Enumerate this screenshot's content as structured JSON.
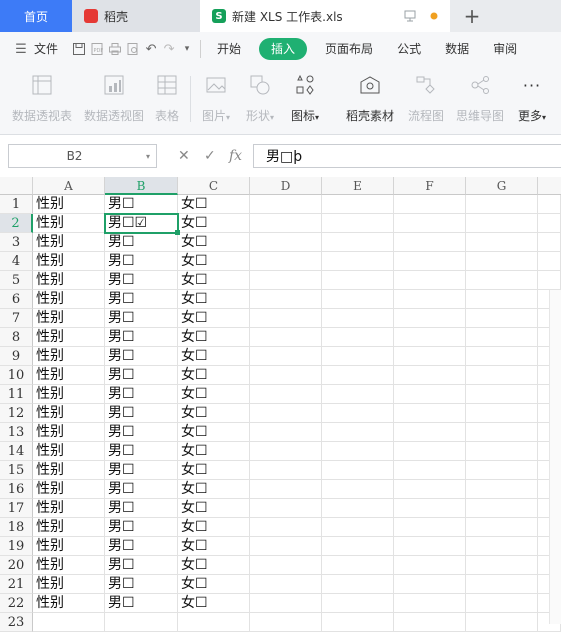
{
  "tabs": {
    "home": "首页",
    "daoke": "稻壳",
    "file": "新建 XLS 工作表.xls"
  },
  "menu": {
    "file": "文件",
    "items": [
      "开始",
      "插入",
      "页面布局",
      "公式",
      "数据",
      "审阅"
    ],
    "active": "插入"
  },
  "ribbon": [
    {
      "label": "数据透视表",
      "icon": "pivot-table-icon",
      "enabled": false
    },
    {
      "label": "数据透视图",
      "icon": "pivot-chart-icon",
      "enabled": false
    },
    {
      "label": "表格",
      "icon": "table-icon",
      "enabled": false
    },
    {
      "label": "图片",
      "icon": "picture-icon",
      "enabled": false,
      "dropdown": true
    },
    {
      "label": "形状",
      "icon": "shape-icon",
      "enabled": false,
      "dropdown": true
    },
    {
      "label": "图标",
      "icon": "icon-library-icon",
      "enabled": true,
      "dropdown": true
    },
    {
      "label": "稻壳素材",
      "icon": "daoke-material-icon",
      "enabled": true
    },
    {
      "label": "流程图",
      "icon": "flowchart-icon",
      "enabled": false
    },
    {
      "label": "思维导图",
      "icon": "mindmap-icon",
      "enabled": false
    },
    {
      "label": "更多",
      "icon": "more-icon",
      "enabled": true,
      "dropdown": true
    }
  ],
  "formula_bar": {
    "cell_ref": "B2",
    "value": "男□þ"
  },
  "columns": [
    "A",
    "B",
    "C",
    "D",
    "E",
    "F",
    "G"
  ],
  "selected_column": "B",
  "selected_row": 2,
  "rows": [
    {
      "n": "1",
      "a": "性别",
      "b": "男☐",
      "c": "女☐"
    },
    {
      "n": "2",
      "a": "性别",
      "b": "男☐☑",
      "c": "女☐"
    },
    {
      "n": "3",
      "a": "性别",
      "b": "男☐",
      "c": "女☐"
    },
    {
      "n": "4",
      "a": "性别",
      "b": "男☐",
      "c": "女☐"
    },
    {
      "n": "5",
      "a": "性别",
      "b": "男☐",
      "c": "女☐"
    },
    {
      "n": "6",
      "a": "性别",
      "b": "男☐",
      "c": "女☐"
    },
    {
      "n": "7",
      "a": "性别",
      "b": "男☐",
      "c": "女☐"
    },
    {
      "n": "8",
      "a": "性别",
      "b": "男☐",
      "c": "女☐"
    },
    {
      "n": "9",
      "a": "性别",
      "b": "男☐",
      "c": "女☐"
    },
    {
      "n": "10",
      "a": "性别",
      "b": "男☐",
      "c": "女☐"
    },
    {
      "n": "11",
      "a": "性别",
      "b": "男☐",
      "c": "女☐"
    },
    {
      "n": "12",
      "a": "性别",
      "b": "男☐",
      "c": "女☐"
    },
    {
      "n": "13",
      "a": "性别",
      "b": "男☐",
      "c": "女☐"
    },
    {
      "n": "14",
      "a": "性别",
      "b": "男☐",
      "c": "女☐"
    },
    {
      "n": "15",
      "a": "性别",
      "b": "男☐",
      "c": "女☐"
    },
    {
      "n": "16",
      "a": "性别",
      "b": "男☐",
      "c": "女☐"
    },
    {
      "n": "17",
      "a": "性别",
      "b": "男☐",
      "c": "女☐"
    },
    {
      "n": "18",
      "a": "性别",
      "b": "男☐",
      "c": "女☐"
    },
    {
      "n": "19",
      "a": "性别",
      "b": "男☐",
      "c": "女☐"
    },
    {
      "n": "20",
      "a": "性别",
      "b": "男☐",
      "c": "女☐"
    },
    {
      "n": "21",
      "a": "性别",
      "b": "男☐",
      "c": "女☐"
    },
    {
      "n": "22",
      "a": "性别",
      "b": "男☐",
      "c": "女☐"
    },
    {
      "n": "23",
      "a": "",
      "b": "",
      "c": ""
    }
  ],
  "colors": {
    "accent_green": "#1fa068",
    "home_tab_blue": "#3d7bf7",
    "insert_tab_green": "#1fb072",
    "unsaved_dot": "#f0a020"
  }
}
